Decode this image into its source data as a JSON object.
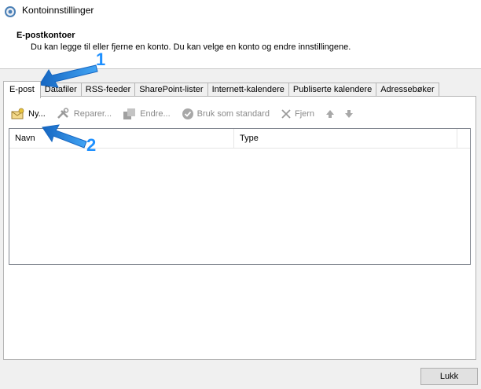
{
  "window": {
    "title": "Kontoinnstillinger"
  },
  "header": {
    "title": "E-postkontoer",
    "description": "Du kan legge til eller fjerne en konto. Du kan velge en konto og endre innstillingene."
  },
  "tabs": [
    {
      "label": "E-post",
      "active": true
    },
    {
      "label": "Datafiler"
    },
    {
      "label": "RSS-feeder"
    },
    {
      "label": "SharePoint-lister"
    },
    {
      "label": "Internett-kalendere"
    },
    {
      "label": "Publiserte kalendere"
    },
    {
      "label": "Adressebøker"
    }
  ],
  "toolbar": {
    "new_label": "Ny...",
    "repair_label": "Reparer...",
    "change_label": "Endre...",
    "default_label": "Bruk som standard",
    "remove_label": "Fjern"
  },
  "list": {
    "columns": [
      "Navn",
      "Type"
    ]
  },
  "footer": {
    "close_label": "Lukk"
  },
  "callouts": [
    "1",
    "2"
  ],
  "colors": {
    "accent": "#1e90ff",
    "disabled_text": "#8a8a8a"
  },
  "icons": {
    "app": "account-settings-icon",
    "new": "new-mail-icon",
    "repair": "tools-icon",
    "change": "edit-icon",
    "default": "check-circle-icon",
    "remove": "x-icon",
    "up": "arrow-up-icon",
    "down": "arrow-down-icon"
  }
}
